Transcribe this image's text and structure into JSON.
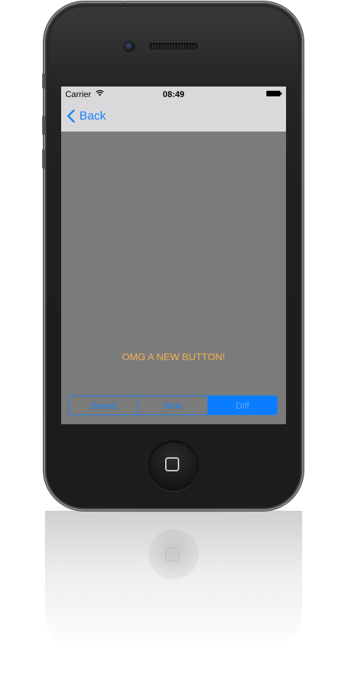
{
  "device": {
    "body_color": "#1e1e1e",
    "bezel_color": "#8d8d8d"
  },
  "status_bar": {
    "carrier": "Carrier",
    "time": "08:49",
    "wifi_icon": "wifi-icon",
    "battery_icon": "battery-icon"
  },
  "nav_bar": {
    "back_label": "Back",
    "back_icon": "chevron-left-icon"
  },
  "content": {
    "background": "#7b7b7b",
    "button_label": "OMG A NEW BUTTON!",
    "button_color": "#f5b24f"
  },
  "segmented_control": {
    "accent": "#1a82f7",
    "segments": [
      {
        "label": "Saved",
        "selected": false
      },
      {
        "label": "New",
        "selected": false
      },
      {
        "label": "Diff",
        "selected": true
      }
    ]
  },
  "home_button": {
    "icon": "home-square-icon"
  }
}
